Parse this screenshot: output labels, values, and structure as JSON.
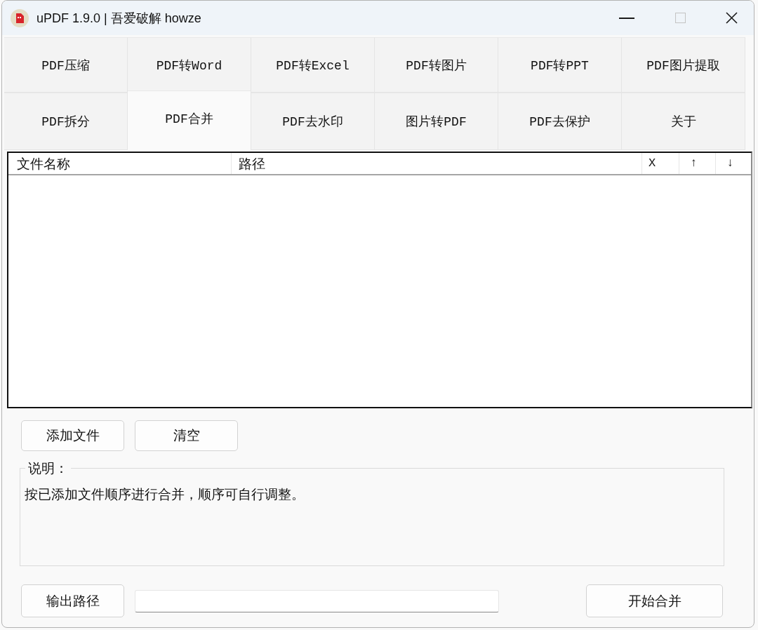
{
  "window": {
    "title": "uPDF 1.9.0 | 吾爱破解 howze",
    "maximize_disabled": true
  },
  "tab_rows": [
    {
      "tabs": [
        {
          "label": "PDF压缩",
          "selected": false
        },
        {
          "label": "PDF转Word",
          "selected": false
        },
        {
          "label": "PDF转Excel",
          "selected": false
        },
        {
          "label": "PDF转图片",
          "selected": false
        },
        {
          "label": "PDF转PPT",
          "selected": false
        },
        {
          "label": "PDF图片提取",
          "selected": false
        }
      ]
    },
    {
      "tabs": [
        {
          "label": "PDF拆分",
          "selected": false
        },
        {
          "label": "PDF合并",
          "selected": true
        },
        {
          "label": "PDF去水印",
          "selected": false
        },
        {
          "label": "图片转PDF",
          "selected": false
        },
        {
          "label": "PDF去保护",
          "selected": false
        },
        {
          "label": "关于",
          "selected": false
        }
      ]
    }
  ],
  "file_table": {
    "columns": [
      "文件名称",
      "路径",
      "X",
      "↑",
      "↓"
    ]
  },
  "list_buttons": [
    "添加文件",
    "清空"
  ],
  "description": {
    "legend": "说明：",
    "text": "按已添加文件顺序进行合并，顺序可自行调整。"
  },
  "output": {
    "button": "输出路径"
  },
  "start_button": "开始合并"
}
